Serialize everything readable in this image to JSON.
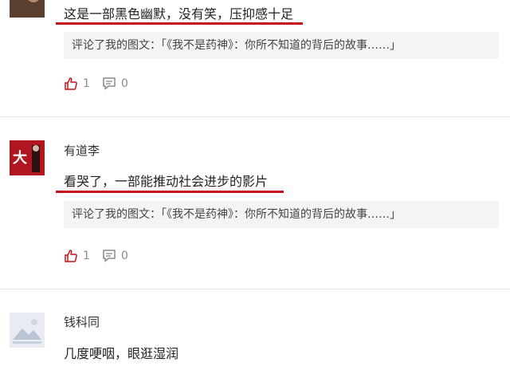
{
  "comments": [
    {
      "username": "",
      "text": "这是一部黑色幽默，没有笑，压抑感十足",
      "reply_prefix": "评论了我的图文：",
      "reply_quote": "「《我不是药神》：你所不知道的背后的故事……」",
      "likes": "1",
      "replies": "0"
    },
    {
      "username": "有道李",
      "text": "看哭了，一部能推动社会进步的影片",
      "reply_prefix": "评论了我的图文：",
      "reply_quote": "「《我不是药神》：你所不知道的背后的故事……」",
      "likes": "1",
      "replies": "0",
      "avatar_text": "大"
    },
    {
      "username": "钱科同",
      "text": "几度哽咽，眼逛湿润"
    }
  ],
  "colors": {
    "accent_red": "#c8101c",
    "muted": "#888888",
    "quote_bg": "#f4f4f4"
  },
  "icons": {
    "like": "thumbs-up-icon",
    "reply": "comment-icon"
  }
}
